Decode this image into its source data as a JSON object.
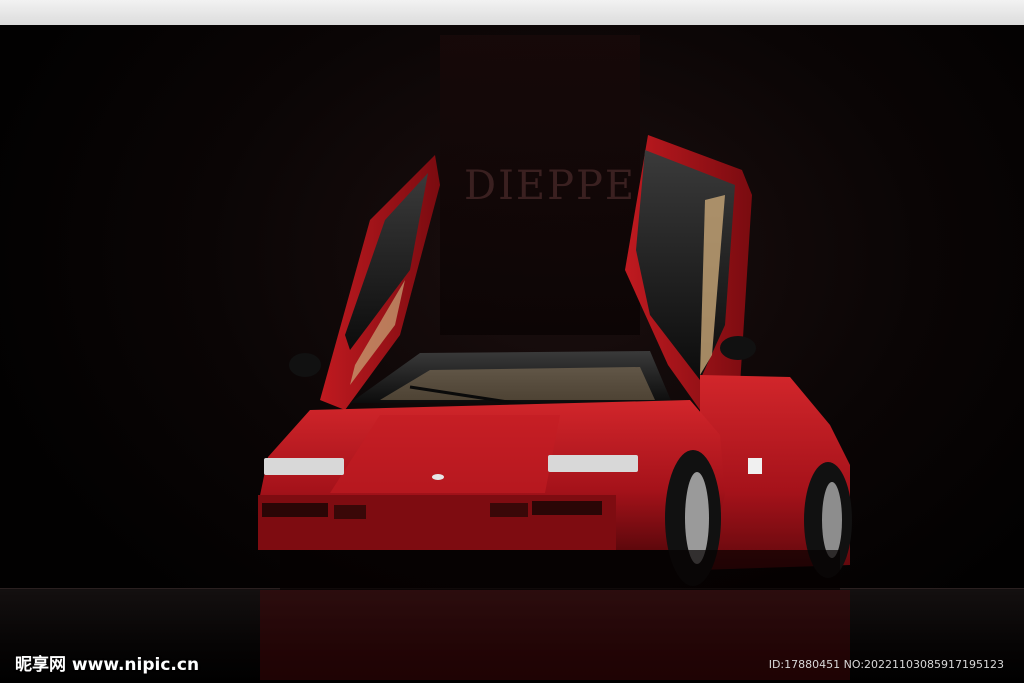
{
  "scene": {
    "backdrop_text": "DIEPPE"
  },
  "watermark": {
    "site": "昵享网 www.nipic.cn",
    "id_text": "ID:17880451 NO:20221103085917195123"
  },
  "colors": {
    "car_red": "#b5141a",
    "car_dark_red": "#6e0a0e",
    "background": "#000000"
  }
}
